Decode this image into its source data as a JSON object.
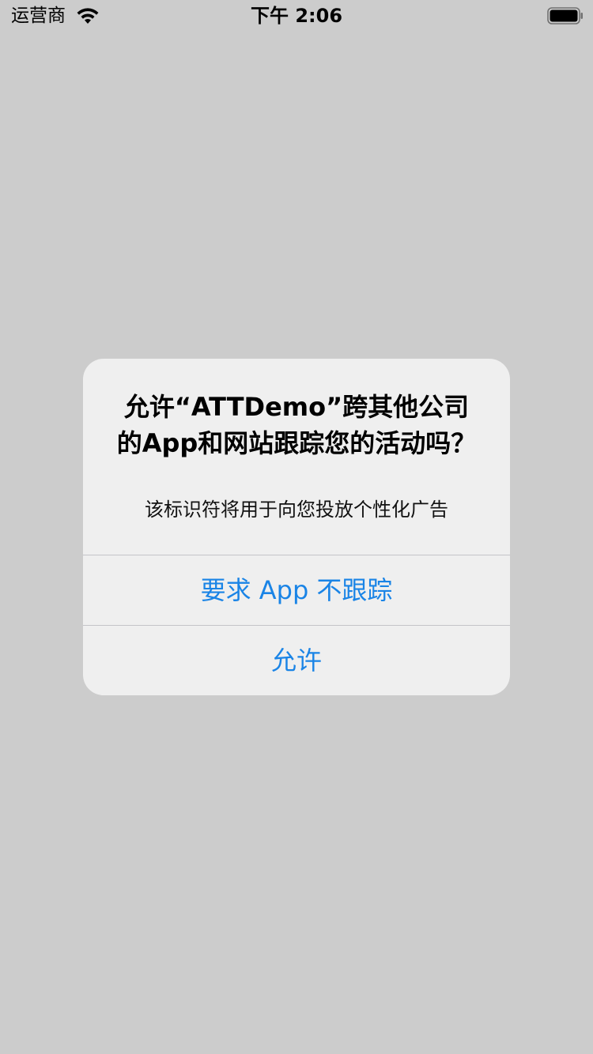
{
  "status_bar": {
    "carrier": "运营商",
    "time": "下午 2:06",
    "wifi_icon": "wifi-icon",
    "battery_icon": "battery-icon"
  },
  "alert": {
    "title": "允许“ATTDemo”跨其他公司的App和网站跟踪您的活动吗？",
    "message": "该标识符将用于向您投放个性化广告",
    "buttons": [
      {
        "label": "要求 App 不跟踪"
      },
      {
        "label": "允许"
      }
    ],
    "button_color": "#1a84e6"
  },
  "colors": {
    "background": "#cccccc",
    "alert_background": "#efefef"
  }
}
